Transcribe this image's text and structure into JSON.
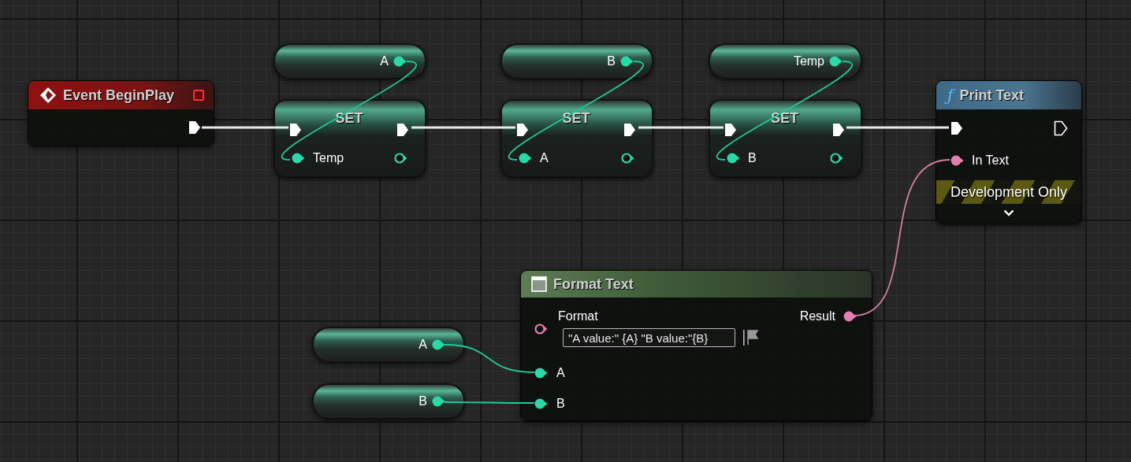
{
  "nodes": [
    {
      "kind": "event",
      "title": "Event BeginPlay"
    },
    {
      "kind": "getter",
      "label": "A"
    },
    {
      "kind": "set",
      "title": "SET",
      "pin": "Temp",
      "output_connected": false
    },
    {
      "kind": "getter",
      "label": "B"
    },
    {
      "kind": "set",
      "title": "SET",
      "pin": "A",
      "output_connected": false
    },
    {
      "kind": "getter",
      "label": "Temp"
    },
    {
      "kind": "set",
      "title": "SET",
      "pin": "B",
      "output_connected": false
    },
    {
      "kind": "function",
      "icon": "ƒ",
      "title": "Print Text",
      "exec_out_connected": false,
      "input": "In Text",
      "badge": "Development Only"
    },
    {
      "kind": "getter",
      "label": "A"
    },
    {
      "kind": "getter",
      "label": "B"
    },
    {
      "kind": "format",
      "title": "Format Text",
      "format_label": "Format",
      "format_connected": false,
      "format_value": "\"A value:\" {A} \"B value:\"{B}",
      "output": "Result",
      "inputs": [
        "A",
        "B"
      ]
    }
  ]
}
